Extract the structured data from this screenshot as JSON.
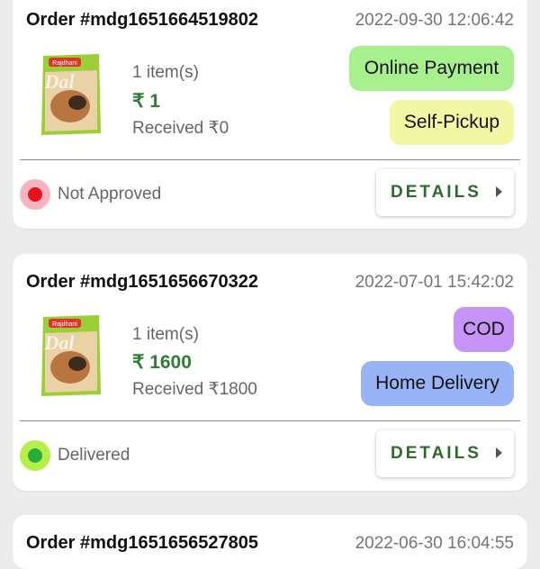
{
  "orders": [
    {
      "id": "Order #mdg1651664519802",
      "date": "2022-09-30 12:06:42",
      "items": "1 item(s)",
      "amount": "₹ 1",
      "received": "Received ₹0",
      "payment": {
        "label": "Online Payment",
        "color": "#a8ef8e"
      },
      "delivery": {
        "label": "Self-Pickup",
        "color": "#f2f7a4"
      },
      "status": {
        "label": "Not Approved",
        "dot": "#e8121e",
        "halo": "#f6b4bf"
      },
      "details": "DETAILS"
    },
    {
      "id": "Order #mdg1651656670322",
      "date": "2022-07-01 15:42:02",
      "items": "1 item(s)",
      "amount": "₹ 1600",
      "received": "Received ₹1800",
      "payment": {
        "label": "COD",
        "color": "#c594f6"
      },
      "delivery": {
        "label": "Home Delivery",
        "color": "#99b4f6"
      },
      "status": {
        "label": "Delivered",
        "dot": "#27ad3a",
        "halo": "#b8ee4a"
      },
      "details": "DETAILS"
    },
    {
      "id": "Order #mdg1651656527805",
      "date": "2022-06-30 16:04:55"
    }
  ],
  "product": {
    "brand": "Rajdhani",
    "name": "Dal"
  }
}
